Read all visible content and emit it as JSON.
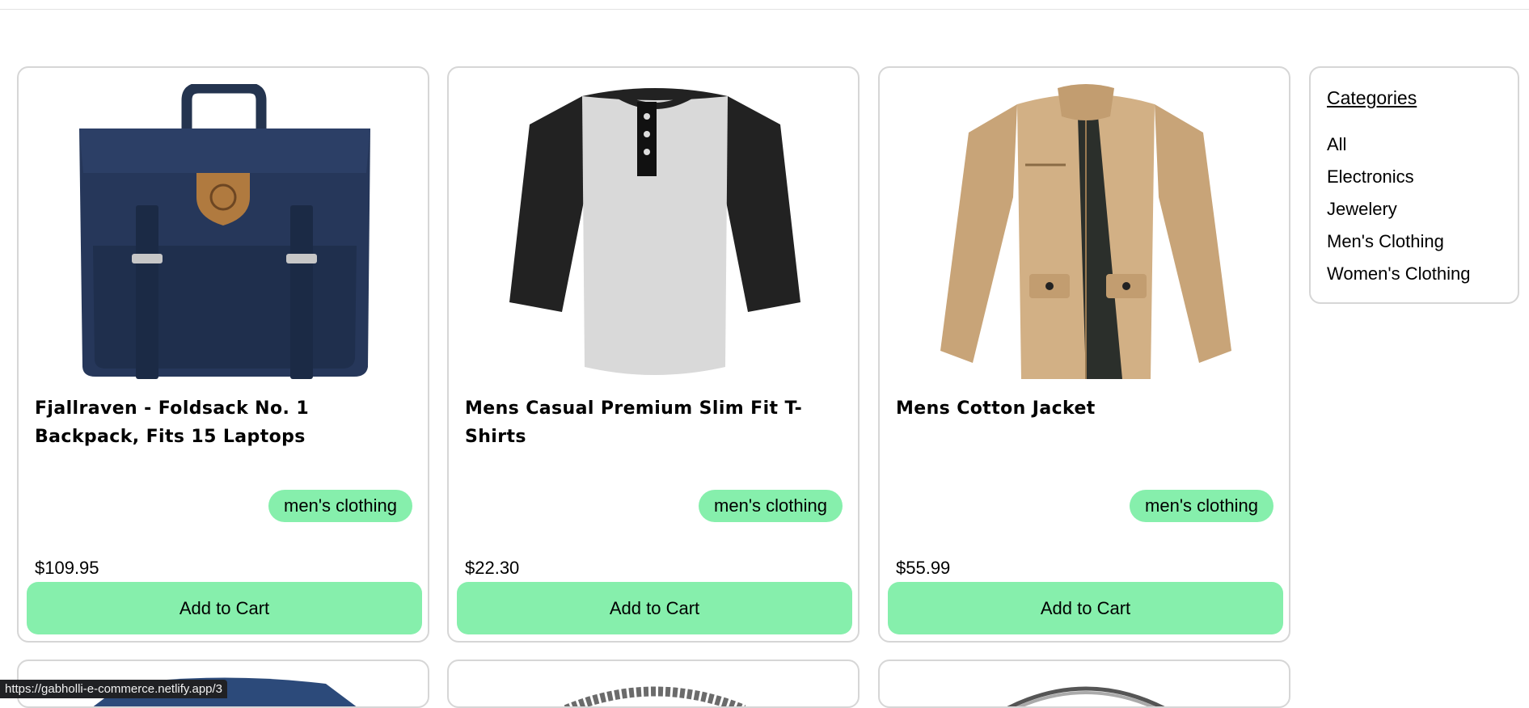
{
  "sidebar": {
    "heading": "Categories",
    "items": [
      {
        "label": "All"
      },
      {
        "label": "Electronics"
      },
      {
        "label": "Jewelery"
      },
      {
        "label": "Men's Clothing"
      },
      {
        "label": "Women's Clothing"
      }
    ]
  },
  "products": [
    {
      "title": "Fjallraven - Foldsack No. 1 Backpack, Fits 15 Laptops",
      "price": "$109.95",
      "category": "men's clothing",
      "button": "Add to Cart",
      "image": "backpack-image"
    },
    {
      "title": "Mens Casual Premium Slim Fit T-Shirts",
      "price": "$22.30",
      "category": "men's clothing",
      "button": "Add to Cart",
      "image": "tshirt-image"
    },
    {
      "title": "Mens Cotton Jacket",
      "price": "$55.99",
      "category": "men's clothing",
      "button": "Add to Cart",
      "image": "jacket-image"
    }
  ],
  "partial_row": [
    "backpack-image",
    "bracelet-image",
    "ring-image"
  ],
  "status_url": "https://gabholli-e-commerce.netlify.app/3",
  "colors": {
    "accent": "#86efac",
    "card_border": "#d6d6d6",
    "status_bg": "#202124"
  }
}
